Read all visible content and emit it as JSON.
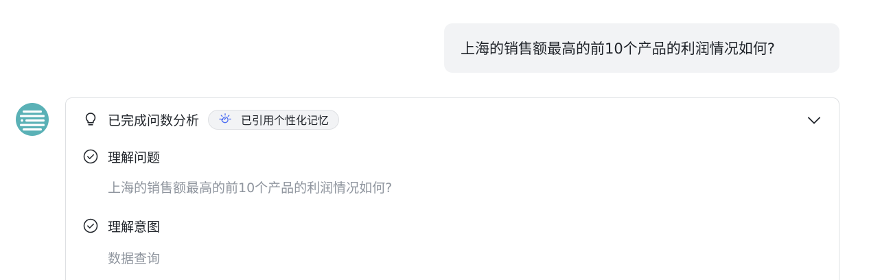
{
  "user_message": {
    "text": "上海的销售额最高的前10个产品的利润情况如何?"
  },
  "analysis_card": {
    "status_title": "已完成问数分析",
    "memory_badge": "已引用个性化记忆",
    "steps": [
      {
        "title": "理解问题",
        "detail": "上海的销售额最高的前10个产品的利润情况如何?"
      },
      {
        "title": "理解意图",
        "detail": "数据查询"
      }
    ]
  },
  "icons": {
    "avatar": "assistant-avatar-icon",
    "status": "lightbulb-icon",
    "memory": "brain-icon",
    "step_done": "check-circle-icon",
    "collapse": "chevron-down-icon"
  },
  "colors": {
    "bubble_bg": "#f2f3f5",
    "avatar_bg": "#5ab1b6",
    "brain_icon": "#4e6ef2",
    "muted_text": "#8f959e"
  }
}
